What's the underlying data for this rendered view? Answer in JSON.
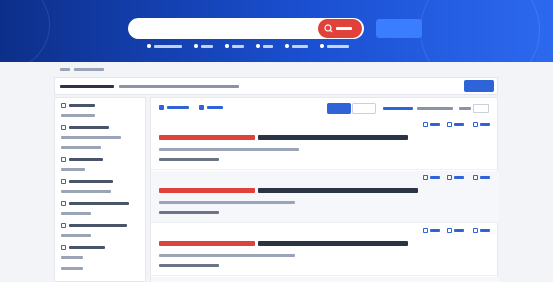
{
  "colors": {
    "header_bg": "#1a4fd0",
    "search_btn": "#e0413a",
    "accent": "#2f63d8",
    "highlight": "#e0413a",
    "page_bg": "#f3f4f7"
  },
  "header": {
    "search_icon": "search-icon"
  },
  "toolbar": {
    "download_icon": "download-icon",
    "visual_icon": "chart-icon"
  },
  "results": [
    {
      "title_icon": "document-icon"
    },
    {
      "title_icon": "document-icon"
    },
    {
      "title_icon": "document-icon"
    },
    {
      "title_icon": "document-icon"
    }
  ]
}
